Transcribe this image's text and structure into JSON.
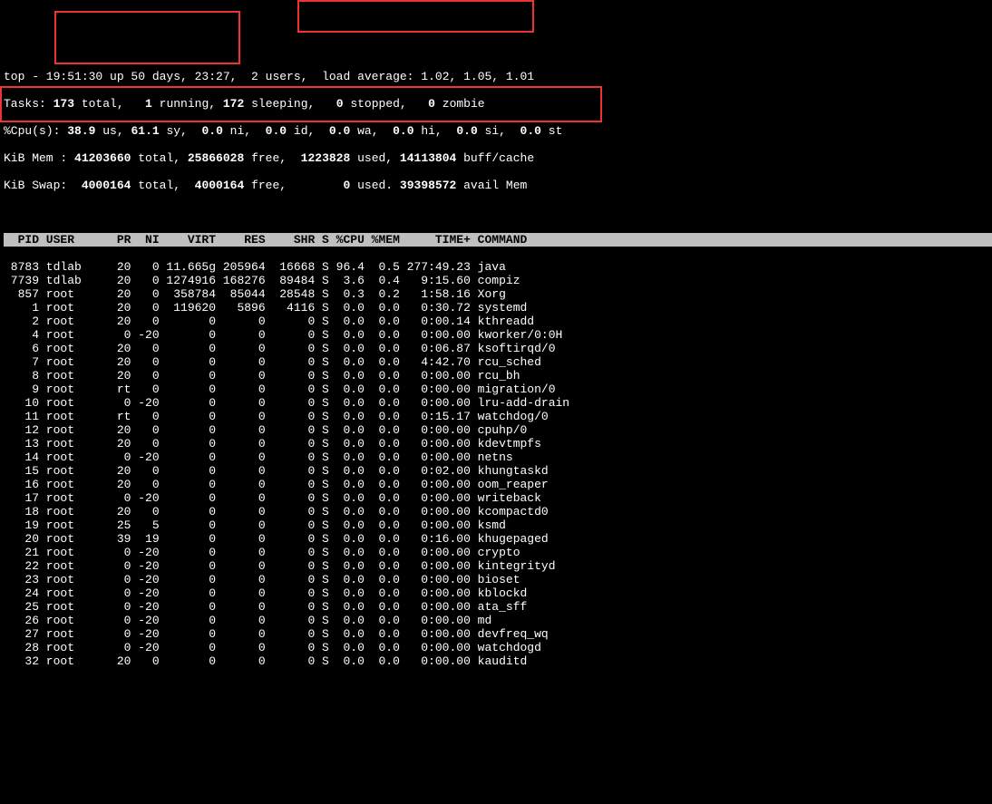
{
  "summary": {
    "line1_a": "top - 19:51:30 up 50 days, 23:27,  2 users,",
    "line1_b": "  load average: 1.02, 1.05, 1.01",
    "line2_a": "Tasks:",
    "line2_b": " 173 ",
    "line2_c": "total,",
    "line2_d": "   1 ",
    "line2_e": "running,",
    "line2_f": " 172 ",
    "line2_g": "sleeping,",
    "line2_h": "   0 ",
    "line2_i": "stopped,",
    "line2_j": "   0 ",
    "line2_k": "zombie",
    "line3_a": "%Cpu(s):",
    "line3_b": " 38.9 ",
    "line3_c": "us,",
    "line3_d": " 61.1 ",
    "line3_e": "sy,",
    "line3_f": "  0.0 ",
    "line3_g": "ni,",
    "line3_h": "  0.0 ",
    "line3_i": "id,",
    "line3_j": "  0.0 ",
    "line3_k": "wa,",
    "line3_l": "  0.0 ",
    "line3_m": "hi,",
    "line3_n": "  0.0 ",
    "line3_o": "si,",
    "line3_p": "  0.0 ",
    "line3_q": "st",
    "line4_a": "KiB Mem :",
    "line4_b": " 41203660 ",
    "line4_c": "total,",
    "line4_d": " 25866028 ",
    "line4_e": "free,",
    "line4_f": "  1223828 ",
    "line4_g": "used,",
    "line4_h": " 14113804 ",
    "line4_i": "buff/cache",
    "line5_a": "KiB Swap:",
    "line5_b": "  4000164 ",
    "line5_c": "total,",
    "line5_d": "  4000164 ",
    "line5_e": "free,",
    "line5_f": "        0 ",
    "line5_g": "used.",
    "line5_h": " 39398572 ",
    "line5_i": "avail Mem"
  },
  "header": "  PID USER      PR  NI    VIRT    RES    SHR S %CPU %MEM     TIME+ COMMAND                                                                         ",
  "rows": [
    " 8783 tdlab     20   0 11.665g 205964  16668 S 96.4  0.5 277:49.23 java",
    " 7739 tdlab     20   0 1274916 168276  89484 S  3.6  0.4   9:15.60 compiz",
    "  857 root      20   0  358784  85044  28548 S  0.3  0.2   1:58.16 Xorg",
    "    1 root      20   0  119620   5896   4116 S  0.0  0.0   0:30.72 systemd",
    "    2 root      20   0       0      0      0 S  0.0  0.0   0:00.14 kthreadd",
    "    4 root       0 -20       0      0      0 S  0.0  0.0   0:00.00 kworker/0:0H",
    "    6 root      20   0       0      0      0 S  0.0  0.0   0:06.87 ksoftirqd/0",
    "    7 root      20   0       0      0      0 S  0.0  0.0   4:42.70 rcu_sched",
    "    8 root      20   0       0      0      0 S  0.0  0.0   0:00.00 rcu_bh",
    "    9 root      rt   0       0      0      0 S  0.0  0.0   0:00.00 migration/0",
    "   10 root       0 -20       0      0      0 S  0.0  0.0   0:00.00 lru-add-drain",
    "   11 root      rt   0       0      0      0 S  0.0  0.0   0:15.17 watchdog/0",
    "   12 root      20   0       0      0      0 S  0.0  0.0   0:00.00 cpuhp/0",
    "   13 root      20   0       0      0      0 S  0.0  0.0   0:00.00 kdevtmpfs",
    "   14 root       0 -20       0      0      0 S  0.0  0.0   0:00.00 netns",
    "   15 root      20   0       0      0      0 S  0.0  0.0   0:02.00 khungtaskd",
    "   16 root      20   0       0      0      0 S  0.0  0.0   0:00.00 oom_reaper",
    "   17 root       0 -20       0      0      0 S  0.0  0.0   0:00.00 writeback",
    "   18 root      20   0       0      0      0 S  0.0  0.0   0:00.00 kcompactd0",
    "   19 root      25   5       0      0      0 S  0.0  0.0   0:00.00 ksmd",
    "   20 root      39  19       0      0      0 S  0.0  0.0   0:16.00 khugepaged",
    "   21 root       0 -20       0      0      0 S  0.0  0.0   0:00.00 crypto",
    "   22 root       0 -20       0      0      0 S  0.0  0.0   0:00.00 kintegrityd",
    "   23 root       0 -20       0      0      0 S  0.0  0.0   0:00.00 bioset",
    "   24 root       0 -20       0      0      0 S  0.0  0.0   0:00.00 kblockd",
    "   25 root       0 -20       0      0      0 S  0.0  0.0   0:00.00 ata_sff",
    "   26 root       0 -20       0      0      0 S  0.0  0.0   0:00.00 md",
    "   27 root       0 -20       0      0      0 S  0.0  0.0   0:00.00 devfreq_wq",
    "   28 root       0 -20       0      0      0 S  0.0  0.0   0:00.00 watchdogd",
    "   32 root      20   0       0      0      0 S  0.0  0.0   0:00.00 kauditd"
  ]
}
